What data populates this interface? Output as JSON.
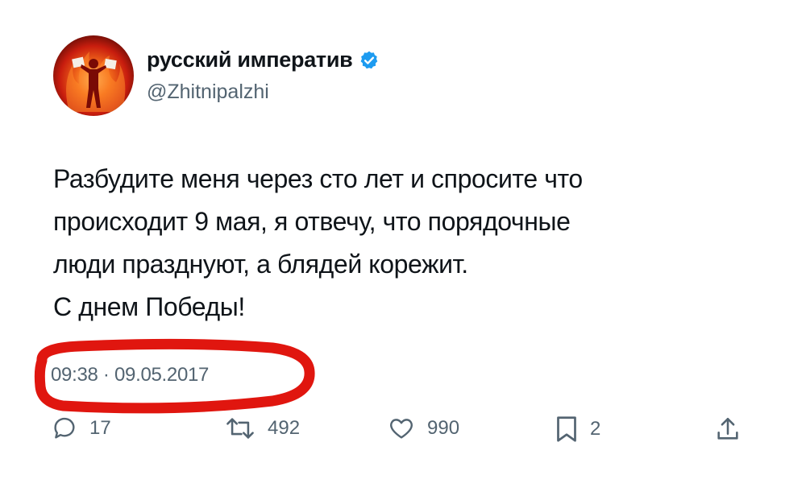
{
  "author": {
    "display_name": "русский императив",
    "handle": "@Zhitnipalzhi",
    "avatar_icon": "flame-figure-avatar",
    "verified_icon": "verified-badge-icon",
    "verified_color": "#1d9bf0"
  },
  "tweet": {
    "lines": [
      "Разбудите меня через сто лет и спросите что",
      "происходит 9 мая, я отвечу, что порядочные",
      "люди празднуют, а блядей корежит.",
      "С днем Победы!"
    ]
  },
  "meta": {
    "timestamp": "09:38 · 09.05.2017",
    "highlight_color": "#e0160f"
  },
  "actions": {
    "replies": "17",
    "reposts": "492",
    "likes": "990",
    "bookmarks": "2",
    "share_icon": "share-icon"
  },
  "colors": {
    "text": "#0f1419",
    "secondary": "#536471"
  }
}
